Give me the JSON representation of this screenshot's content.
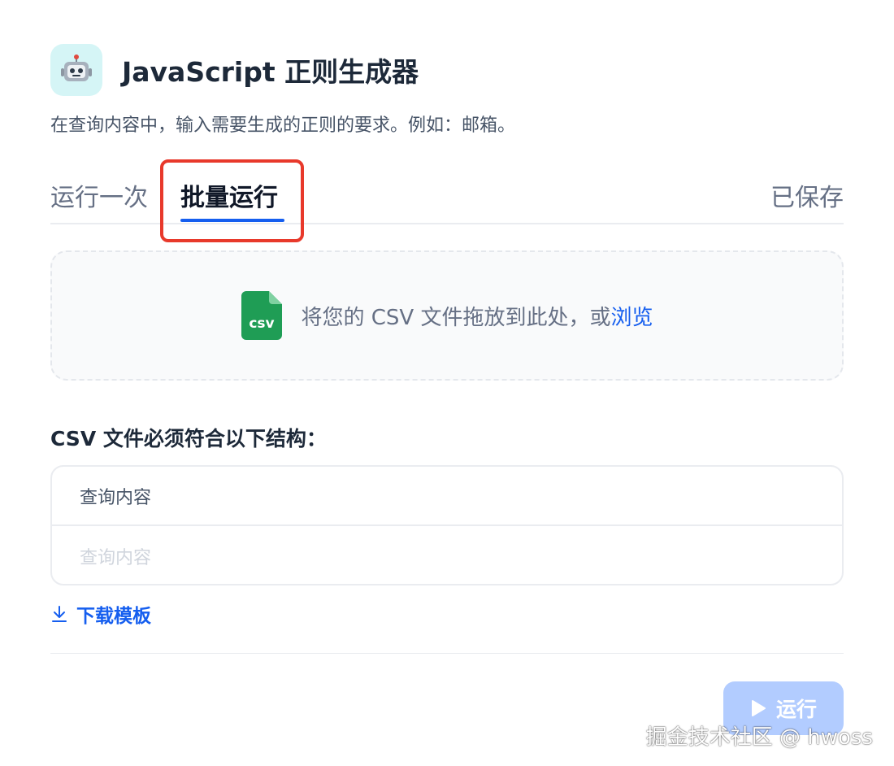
{
  "app": {
    "icon": "robot-icon",
    "title": "JavaScript 正则生成器",
    "description": "在查询内容中，输入需要生成的正则的要求。例如：邮箱。"
  },
  "tabs": [
    {
      "label": "运行一次",
      "active": false
    },
    {
      "label": "批量运行",
      "active": true
    }
  ],
  "saved_tab": {
    "label": "已保存"
  },
  "dropzone": {
    "icon": "csv-file-icon",
    "icon_text": "csv",
    "text": "将您的 CSV 文件拖放到此处，或",
    "browse_label": "浏览"
  },
  "structure": {
    "label": "CSV 文件必须符合以下结构：",
    "header": "查询内容",
    "placeholder_row": "查询内容"
  },
  "download": {
    "icon": "download-icon",
    "label": "下载模板"
  },
  "run_button": {
    "icon": "play-icon",
    "label": "运行",
    "enabled": false
  },
  "watermark": "掘金技术社区 @ hwoss",
  "colors": {
    "accent": "#155eef",
    "highlight": "#e8392b",
    "run_disabled": "#b2ccff",
    "csv_green": "#1f9d55",
    "app_icon_bg": "#d5f5f6"
  }
}
